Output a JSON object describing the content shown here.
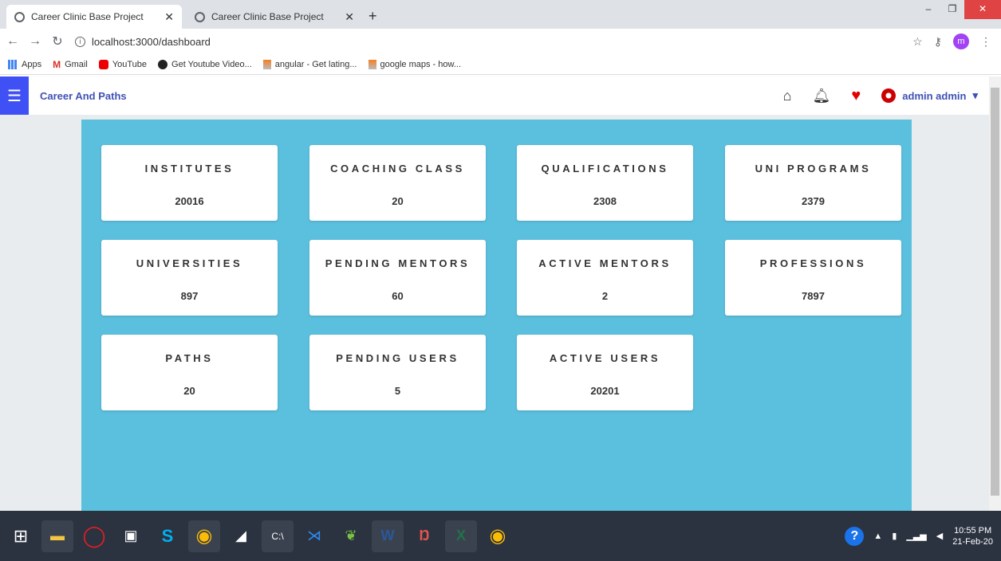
{
  "browser": {
    "tabs": [
      {
        "label": "Career Clinic Base Project"
      },
      {
        "label": "Career Clinic Base Project"
      }
    ],
    "url": "localhost:3000/dashboard",
    "bookmarks": [
      {
        "label": "Apps"
      },
      {
        "label": "Gmail"
      },
      {
        "label": "YouTube"
      },
      {
        "label": "Get Youtube Video..."
      },
      {
        "label": "angular - Get lating..."
      },
      {
        "label": "google maps - how..."
      }
    ],
    "profile_initial": "m"
  },
  "header": {
    "title": "Career And Paths",
    "user": "admin admin"
  },
  "cards": [
    {
      "label": "INSTITUTES",
      "value": "20016"
    },
    {
      "label": "COACHING CLASS",
      "value": "20"
    },
    {
      "label": "QUALIFICATIONS",
      "value": "2308"
    },
    {
      "label": "UNI PROGRAMS",
      "value": "2379"
    },
    {
      "label": "UNIVERSITIES",
      "value": "897"
    },
    {
      "label": "PENDING MENTORS",
      "value": "60"
    },
    {
      "label": "ACTIVE MENTORS",
      "value": "2"
    },
    {
      "label": "PROFESSIONS",
      "value": "7897"
    },
    {
      "label": "PATHS",
      "value": "20"
    },
    {
      "label": "PENDING USERS",
      "value": "5"
    },
    {
      "label": "ACTIVE USERS",
      "value": "20201"
    }
  ],
  "taskbar": {
    "time": "10:55 PM",
    "date": "21-Feb-20"
  },
  "colors": {
    "panel": "#5bc0de",
    "accent": "#3f51f5"
  }
}
